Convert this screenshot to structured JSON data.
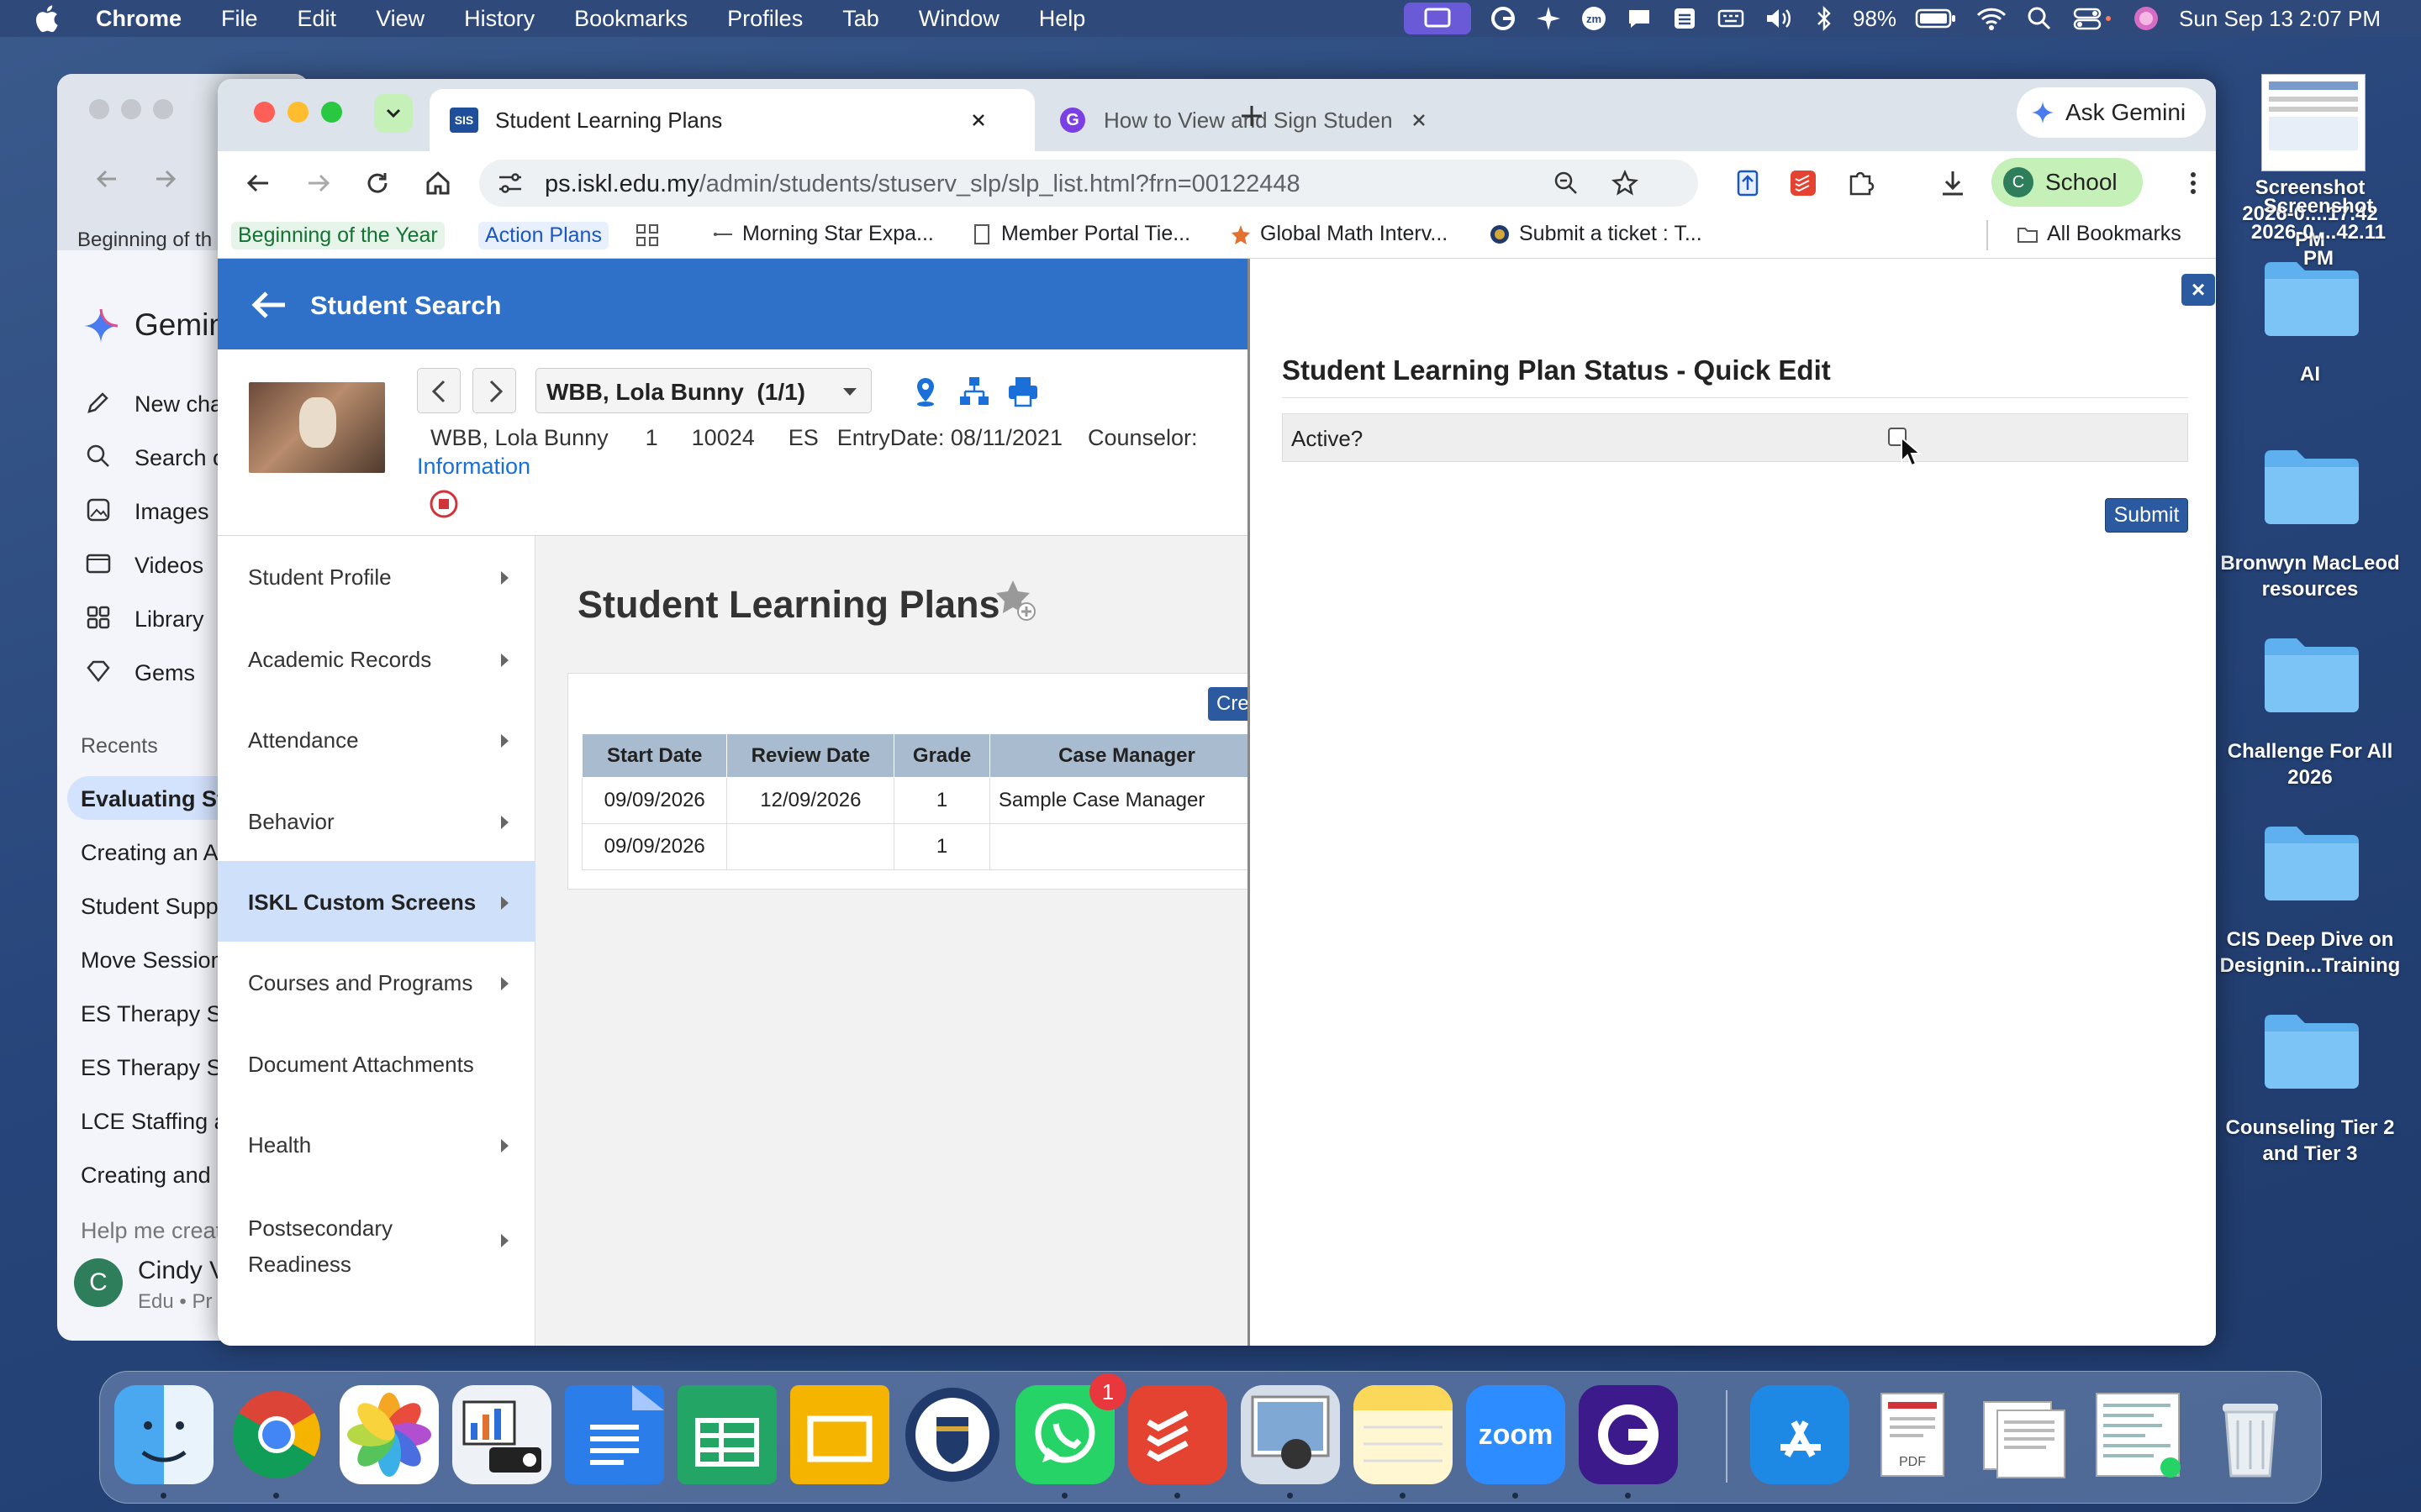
{
  "menubar": {
    "items": [
      "Chrome",
      "File",
      "Edit",
      "View",
      "History",
      "Bookmarks",
      "Profiles",
      "Tab",
      "Window",
      "Help"
    ],
    "battery": "98%",
    "datetime": "Sun Sep 13  2:07 PM"
  },
  "desktop": {
    "icons": [
      {
        "label": "Screenshot\n2026-0....17.42 PM"
      },
      {
        "label": "Screenshot\n2026-0....42.11 PM"
      },
      {
        "label": "AI"
      },
      {
        "label": "Bronwyn MacLeod\nresources"
      },
      {
        "label": "Challenge For All\n2026"
      },
      {
        "label": "CIS Deep Dive on\nDesignin...Training"
      },
      {
        "label": "Counseling Tier 2\nand Tier 3"
      }
    ]
  },
  "gemini_window": {
    "crumb": "Beginning of th",
    "title": "Gemin",
    "nav": [
      "New cha",
      "Search c",
      "Images",
      "Videos",
      "Library",
      "Gems"
    ],
    "recents_label": "Recents",
    "recents": [
      "Evaluating St",
      "Creating an A",
      "Student Supp",
      "Move Session",
      "ES Therapy Sc",
      "ES Therapy Sc",
      "LCE Staffing a",
      "Creating and"
    ],
    "help": "Help me creat",
    "user_name": "Cindy V",
    "user_sub": "Edu • Pr",
    "avatar_letter": "C"
  },
  "browser": {
    "tabs": [
      {
        "favicon": "SIS",
        "title": "Student Learning Plans",
        "active": true
      },
      {
        "favicon": "G",
        "title": "How to View and Sign Studen",
        "active": false
      }
    ],
    "ask_gemini": "Ask Gemini",
    "url_host": "ps.iskl.edu.my",
    "url_path": "/admin/students/stuserv_slp/slp_list.html?frn=00122448",
    "profile_letter": "C",
    "profile_name": "School",
    "bookmarks": [
      "Beginning of the Year",
      "Action Plans",
      "Morning Star Expa...",
      "Member Portal Tie...",
      "Global Math Interv...",
      "Submit a ticket : T..."
    ],
    "all_bookmarks": "All Bookmarks"
  },
  "page": {
    "header": "Student Search",
    "student_select": "WBB, Lola Bunny  (1/1)",
    "student_info": {
      "name": "WBB, Lola Bunny",
      "grade": "1",
      "id": "10024",
      "school": "ES",
      "entry": "EntryDate: 08/11/2021",
      "counselor": "Counselor:",
      "info_link": "Information"
    },
    "menu": [
      {
        "label": "Student Profile",
        "arrow": true,
        "selected": false
      },
      {
        "label": "Academic Records",
        "arrow": true,
        "selected": false
      },
      {
        "label": "Attendance",
        "arrow": true,
        "selected": false
      },
      {
        "label": "Behavior",
        "arrow": true,
        "selected": false
      },
      {
        "label": "ISKL Custom Screens",
        "arrow": true,
        "selected": true
      },
      {
        "label": "Courses and Programs",
        "arrow": true,
        "selected": false
      },
      {
        "label": "Document Attachments",
        "arrow": false,
        "selected": false
      },
      {
        "label": "Health",
        "arrow": true,
        "selected": false
      },
      {
        "label": "Postsecondary\nReadiness",
        "arrow": true,
        "selected": false
      }
    ],
    "title": "Student Learning Plans",
    "create_button": "Cre",
    "table": {
      "columns": [
        "Start Date",
        "Review Date",
        "Grade",
        "Case Manager"
      ],
      "rows": [
        [
          "09/09/2026",
          "12/09/2026",
          "1",
          "Sample Case Manager"
        ],
        [
          "09/09/2026",
          "",
          "1",
          ""
        ]
      ]
    }
  },
  "drawer": {
    "title": "Student Learning Plan Status - Quick Edit",
    "field_label": "Active?",
    "field_checked": false,
    "submit": "Submit",
    "close": "×"
  },
  "dock": {
    "apps": [
      "Finder",
      "Chrome",
      "Photos",
      "Keynote",
      "Docs",
      "Sheets",
      "Slides",
      "ISKL",
      "WhatsApp",
      "Todoist",
      "Preview",
      "Notes",
      "Zoom",
      "Gemini",
      "App Store",
      "PDF",
      "Document",
      "Screenshot",
      "Trash"
    ],
    "whatsapp_badge": "1"
  }
}
